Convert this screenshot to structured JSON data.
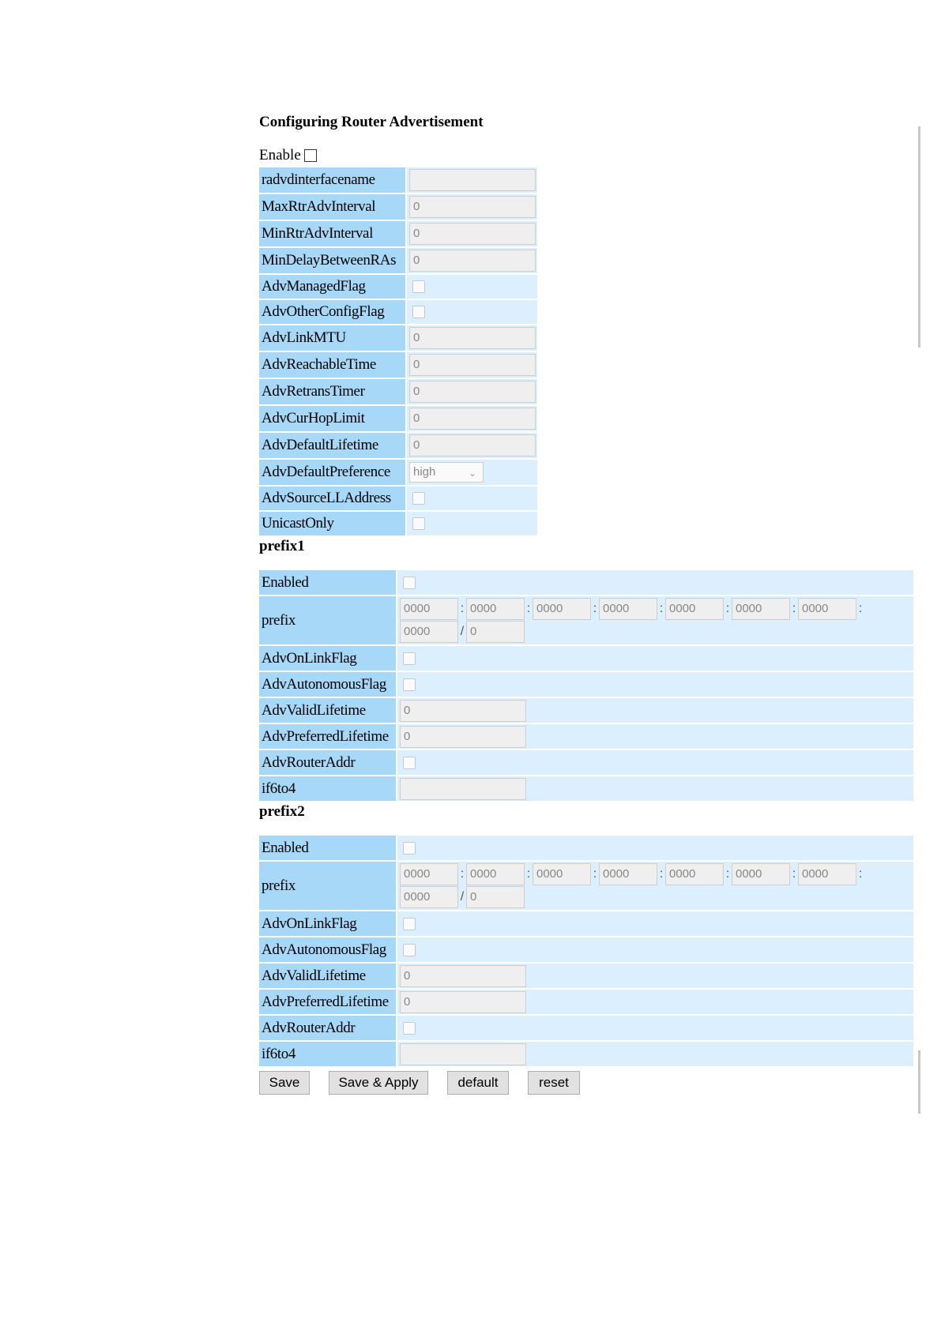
{
  "title": "Configuring Router Advertisement",
  "enable_label": "Enable",
  "main_fields": [
    {
      "label": "radvdinterfacename",
      "type": "text",
      "value": ""
    },
    {
      "label": "MaxRtrAdvInterval",
      "type": "text",
      "value": "0"
    },
    {
      "label": "MinRtrAdvInterval",
      "type": "text",
      "value": "0"
    },
    {
      "label": "MinDelayBetweenRAs",
      "type": "text",
      "value": "0"
    },
    {
      "label": "AdvManagedFlag",
      "type": "checkbox",
      "value": ""
    },
    {
      "label": "AdvOtherConfigFlag",
      "type": "checkbox",
      "value": ""
    },
    {
      "label": "AdvLinkMTU",
      "type": "text",
      "value": "0"
    },
    {
      "label": "AdvReachableTime",
      "type": "text",
      "value": "0"
    },
    {
      "label": "AdvRetransTimer",
      "type": "text",
      "value": "0"
    },
    {
      "label": "AdvCurHopLimit",
      "type": "text",
      "value": "0"
    },
    {
      "label": "AdvDefaultLifetime",
      "type": "text",
      "value": "0"
    },
    {
      "label": "AdvDefaultPreference",
      "type": "select",
      "value": "high"
    },
    {
      "label": "AdvSourceLLAddress",
      "type": "checkbox",
      "value": ""
    },
    {
      "label": "UnicastOnly",
      "type": "checkbox",
      "value": ""
    }
  ],
  "prefixes": [
    {
      "heading": "prefix1",
      "enabled_label": "Enabled",
      "prefix_label": "prefix",
      "address_parts": [
        "0000",
        "0000",
        "0000",
        "0000",
        "0000",
        "0000",
        "0000",
        "0000"
      ],
      "colon": ":",
      "slash": "/",
      "prefix_length": "0",
      "fields": [
        {
          "label": "AdvOnLinkFlag",
          "type": "checkbox",
          "value": ""
        },
        {
          "label": "AdvAutonomousFlag",
          "type": "checkbox",
          "value": ""
        },
        {
          "label": "AdvValidLifetime",
          "type": "text",
          "value": "0"
        },
        {
          "label": "AdvPreferredLifetime",
          "type": "text",
          "value": "0"
        },
        {
          "label": "AdvRouterAddr",
          "type": "checkbox",
          "value": ""
        },
        {
          "label": "if6to4",
          "type": "text",
          "value": ""
        }
      ]
    },
    {
      "heading": "prefix2",
      "enabled_label": "Enabled",
      "prefix_label": "prefix",
      "address_parts": [
        "0000",
        "0000",
        "0000",
        "0000",
        "0000",
        "0000",
        "0000",
        "0000"
      ],
      "colon": ":",
      "slash": "/",
      "prefix_length": "0",
      "fields": [
        {
          "label": "AdvOnLinkFlag",
          "type": "checkbox",
          "value": ""
        },
        {
          "label": "AdvAutonomousFlag",
          "type": "checkbox",
          "value": ""
        },
        {
          "label": "AdvValidLifetime",
          "type": "text",
          "value": "0"
        },
        {
          "label": "AdvPreferredLifetime",
          "type": "text",
          "value": "0"
        },
        {
          "label": "AdvRouterAddr",
          "type": "checkbox",
          "value": ""
        },
        {
          "label": "if6to4",
          "type": "text",
          "value": ""
        }
      ]
    }
  ],
  "buttons": {
    "save": "Save",
    "save_apply": "Save & Apply",
    "default": "default",
    "reset": "reset"
  },
  "colors": {
    "label_bg": "#a8d8f8",
    "value_bg": "#dcefff",
    "input_bg": "#efefef",
    "button_bg": "#e1e1e1"
  }
}
